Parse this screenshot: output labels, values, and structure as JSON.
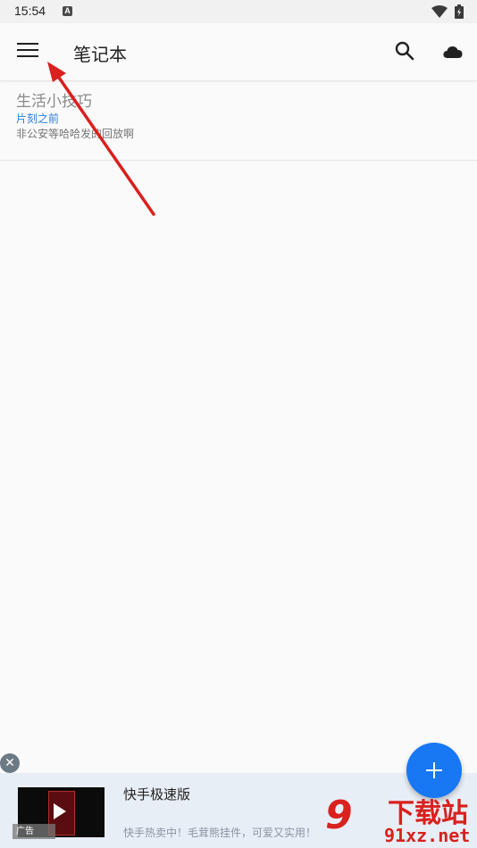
{
  "status_bar": {
    "time": "15:54",
    "notification_icon": "A"
  },
  "app_bar": {
    "title": "笔记本",
    "menu_icon": "menu-icon",
    "search_icon": "search-icon",
    "cloud_icon": "cloud-icon"
  },
  "notes": [
    {
      "title": "生活小技巧",
      "time": "片刻之前",
      "preview": "非公安等哈哈发的回放啊"
    }
  ],
  "ad": {
    "app_name": "快手极速版",
    "description": "快手热卖中！毛茸熊挂件，可爱又实用！",
    "label": "广告",
    "close_icon": "close-icon",
    "play_icon": "play-icon"
  },
  "fab": {
    "icon": "add-icon"
  },
  "watermark": {
    "logo": "9",
    "text": "下载站",
    "url": "91xz.net"
  },
  "colors": {
    "accent": "#1877f2",
    "link": "#2a7de1",
    "annotation_arrow": "#d9211e"
  }
}
